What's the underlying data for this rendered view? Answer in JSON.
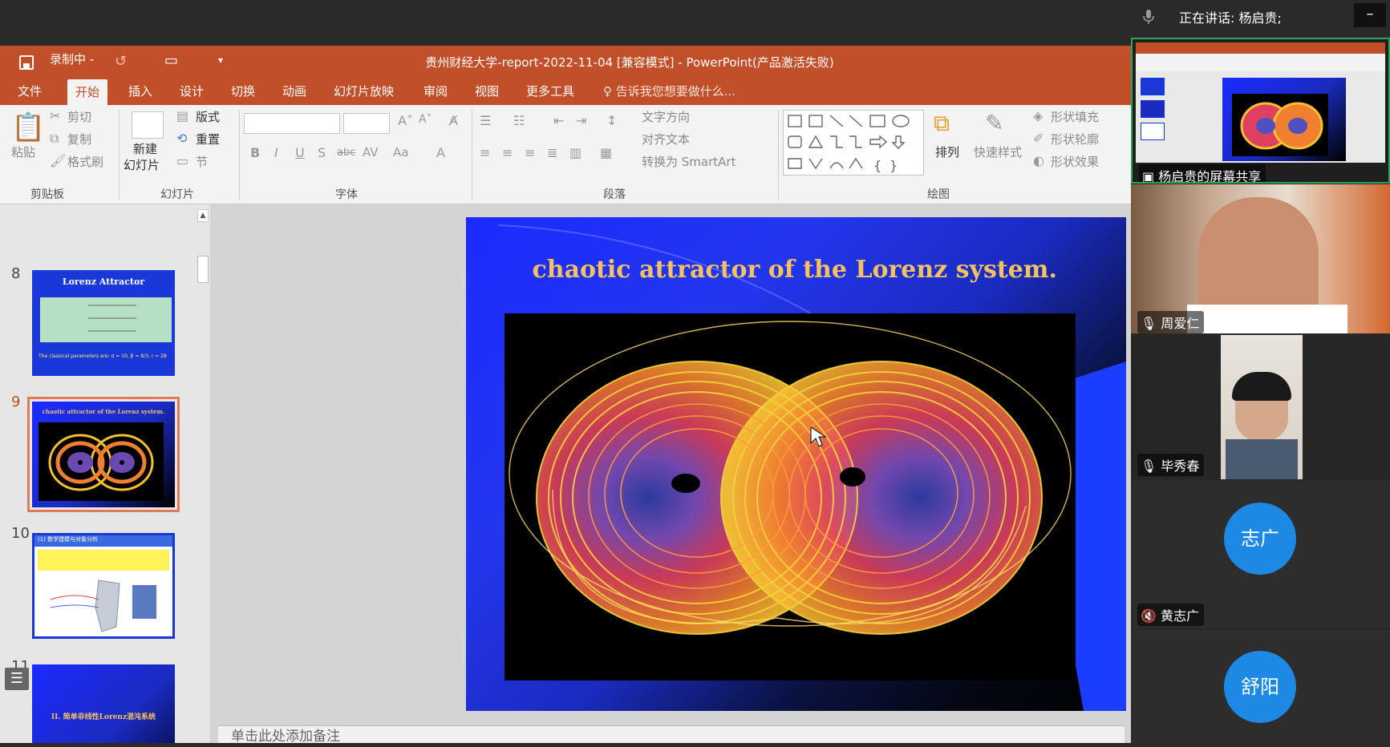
{
  "meeting": {
    "speaking": "正在讲话: 杨启贵;",
    "minimize": "–"
  },
  "ppt": {
    "quick_access": {
      "recording": "录制中 -"
    },
    "title": "贵州财经大学-report-2022-11-04 [兼容模式] - PowerPoint(产品激活失败)",
    "tabs": [
      "文件",
      "开始",
      "插入",
      "设计",
      "切换",
      "动画",
      "幻灯片放映",
      "审阅",
      "视图",
      "更多工具"
    ],
    "active_tab": "开始",
    "tell_me": "告诉我您想要做什么...",
    "ribbon": {
      "clipboard": {
        "label": "剪贴板",
        "paste": "粘贴",
        "cut": "剪切",
        "copy": "复制",
        "format_painter": "格式刷"
      },
      "slides": {
        "label": "幻灯片",
        "new_slide": "新建",
        "new_slide2": "幻灯片",
        "layout": "版式",
        "reset": "重置",
        "section": "节"
      },
      "font": {
        "label": "字体"
      },
      "paragraph": {
        "label": "段落",
        "text_direction": "文字方向",
        "align_text": "对齐文本",
        "smartart": "转换为 SmartArt"
      },
      "drawing": {
        "label": "绘图",
        "arrange": "排列",
        "quick_styles": "快速样式",
        "shape_fill": "形状填充",
        "shape_outline": "形状轮廓",
        "shape_effects": "形状效果"
      }
    },
    "thumbnails": [
      {
        "number": "8",
        "title": "Lorenz Attractor",
        "text": "The classical parameters are: σ = 10, β = 8/3, r = 28"
      },
      {
        "number": "9",
        "title": "chaotic attractor of the Lorenz system."
      },
      {
        "number": "10",
        "title": "(1) 数学建模与对象分析"
      },
      {
        "number": "11",
        "title": "II. 简单非线性Lorenz混沌系统"
      }
    ],
    "slide": {
      "title": "chaotic attractor of the Lorenz system."
    },
    "notes_placeholder": "单击此处添加备注"
  },
  "participants": [
    {
      "name": "杨启贵的屏幕共享",
      "type": "screen-share"
    },
    {
      "name": "周爱仁",
      "type": "video"
    },
    {
      "name": "毕秀春",
      "type": "video"
    },
    {
      "name": "黄志广",
      "type": "avatar",
      "avatar_text": "志广",
      "muted": true
    },
    {
      "name": "舒阳",
      "type": "avatar",
      "avatar_text": "舒阳"
    }
  ]
}
